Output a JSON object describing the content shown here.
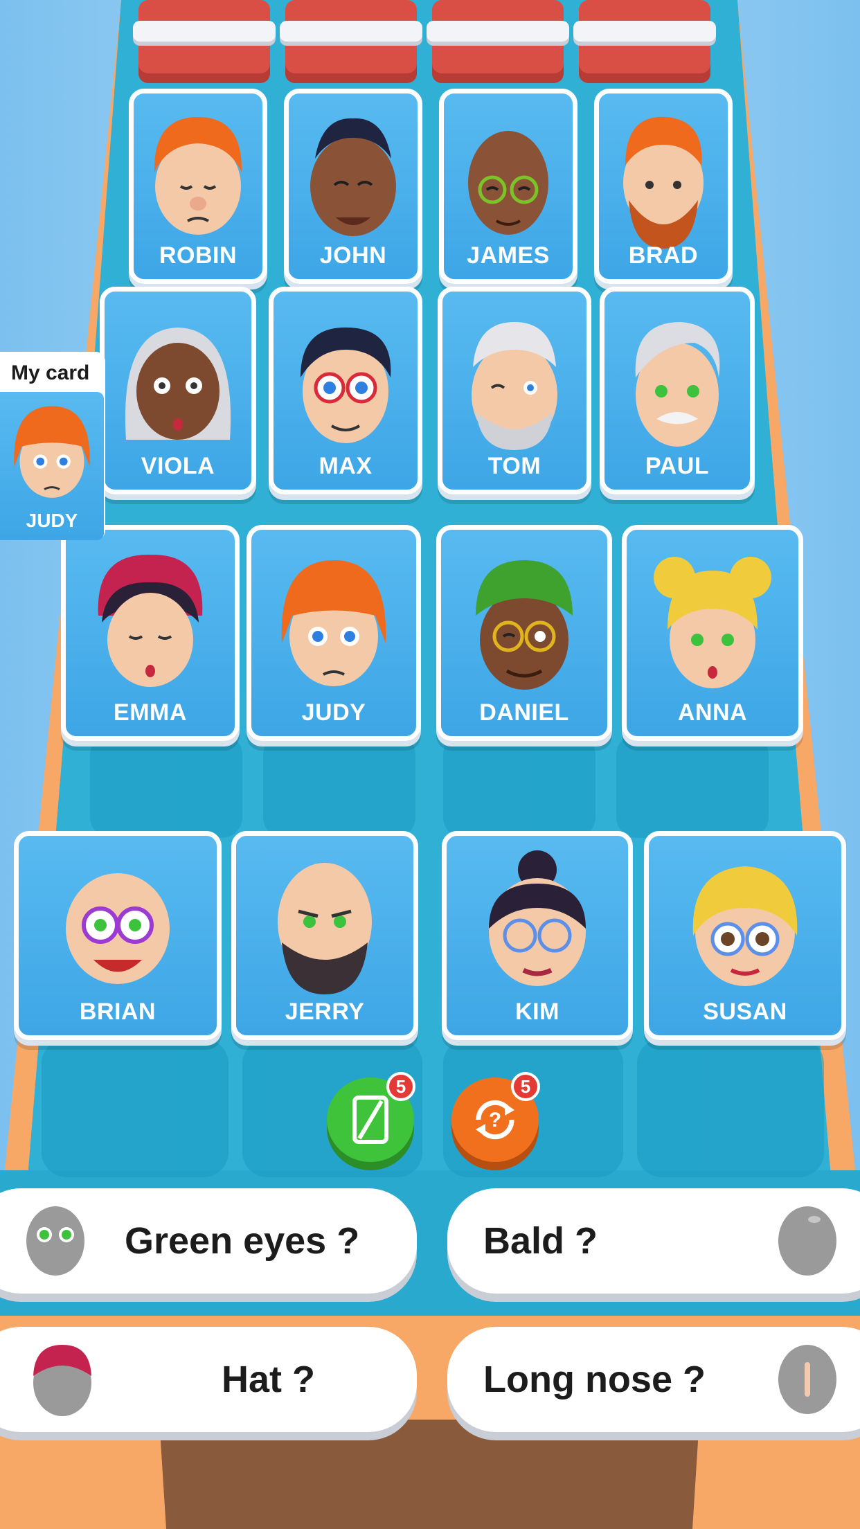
{
  "my_card": {
    "title": "My card",
    "name": "JUDY"
  },
  "cards": [
    {
      "name": "ROBIN"
    },
    {
      "name": "JOHN"
    },
    {
      "name": "JAMES"
    },
    {
      "name": "BRAD"
    },
    {
      "name": "VIOLA"
    },
    {
      "name": "MAX"
    },
    {
      "name": "TOM"
    },
    {
      "name": "PAUL"
    },
    {
      "name": "EMMA"
    },
    {
      "name": "JUDY"
    },
    {
      "name": "DANIEL"
    },
    {
      "name": "ANNA"
    },
    {
      "name": "BRIAN"
    },
    {
      "name": "JERRY"
    },
    {
      "name": "KIM"
    },
    {
      "name": "SUSAN"
    }
  ],
  "actions": {
    "guess": {
      "icon": "card-icon",
      "badge": "5",
      "color": "#3fc33a"
    },
    "swap": {
      "icon": "question-refresh-icon",
      "badge": "5",
      "color": "#f0701e"
    }
  },
  "questions": [
    {
      "label": "Green eyes ?",
      "icon": "green-eyes-head-icon"
    },
    {
      "label": "Bald ?",
      "icon": "bald-head-icon"
    },
    {
      "label": "Hat ?",
      "icon": "hat-head-icon"
    },
    {
      "label": "Long nose ?",
      "icon": "long-nose-head-icon"
    }
  ],
  "colors": {
    "board": "#30b5d8",
    "card": "#4ab0ec",
    "table": "#f7a866",
    "slot_red": "#d94f46"
  }
}
